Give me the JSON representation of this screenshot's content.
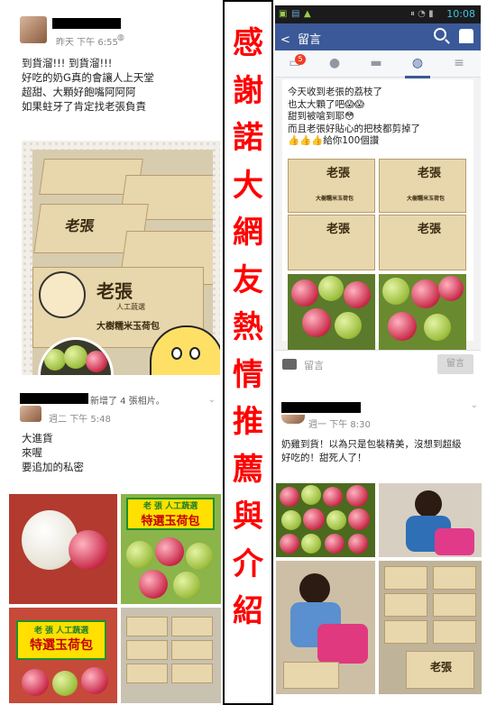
{
  "title_strip": {
    "text": "感謝諾大網友熱情推薦與介紹"
  },
  "post1": {
    "time": "昨天 下午 6:55",
    "text_lines": [
      "到貨溜!!! 到貨溜!!!",
      "好吃的奶G真的會讓人上天堂",
      "超甜、大顆好飽嘴阿阿阿",
      "如果蛀牙了肯定找老張負責"
    ],
    "box_label": "老張",
    "box_sub": "大樹糯米玉荷包",
    "box_small": "人工蔬選"
  },
  "phone": {
    "status_time": "10:08",
    "header_title": "留言",
    "back_glyph": "<",
    "notification_count": "5",
    "post_lines": [
      "今天收到老張的荔枝了",
      "也太大顆了吧😱😱",
      "甜到被嗆到耶😳",
      "而且老張好貼心的把枝都剪掉了",
      "👍👍👍給你100個讚"
    ],
    "box_label": "老張",
    "box_sub": "大樹糯米玉荷包",
    "comment_placeholder": "留言",
    "comment_button": "留言"
  },
  "post2": {
    "action": "新增了 4 張相片。",
    "time": "週二 下午 5:48",
    "text_lines": [
      "大進貨",
      "來喔",
      "要追加的私密"
    ],
    "sign_top": "老 張 人工蔬選",
    "sign_main": "特選玉荷包"
  },
  "post3": {
    "time": "週一 下午 8:30",
    "text_lines": [
      "奶雞到貨！以為只是包裝精美，沒想到超級",
      "好吃的！甜死人了！"
    ],
    "box_label": "老張"
  },
  "icons": {
    "search": "⌕",
    "camera": "📷",
    "globe": "🌐",
    "chevron": "⌄",
    "people": "👥",
    "chat": "💬",
    "menu": "≡"
  },
  "colors": {
    "title_red": "#ff0000",
    "facebook_blue": "#3b5998",
    "status_cyan": "#3cc6e6"
  }
}
